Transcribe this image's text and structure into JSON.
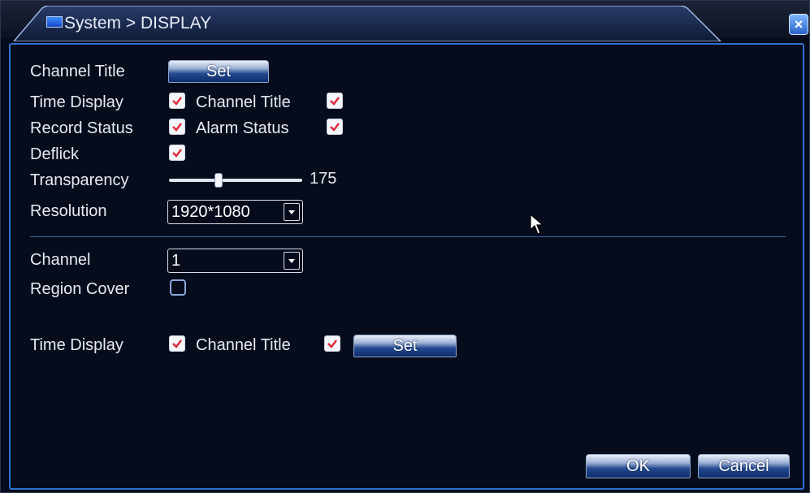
{
  "window": {
    "title": "System > DISPLAY",
    "close_label": "×"
  },
  "global": {
    "channel_title_label": "Channel Title",
    "set_label": "Set",
    "time_display_label": "Time Display",
    "time_display_checked": true,
    "channel_title_check_label": "Channel Title",
    "channel_title_checked": true,
    "record_status_label": "Record Status",
    "record_status_checked": true,
    "alarm_status_label": "Alarm Status",
    "alarm_status_checked": true,
    "deflick_label": "Deflick",
    "deflick_checked": true,
    "transparency_label": "Transparency",
    "transparency_value": "175",
    "transparency_min": 128,
    "transparency_max": 255,
    "resolution_label": "Resolution",
    "resolution_value": "1920*1080"
  },
  "channel_settings": {
    "channel_label": "Channel",
    "channel_value": "1",
    "region_cover_label": "Region Cover",
    "region_cover_checked": false,
    "time_display_label": "Time Display",
    "time_display_checked": true,
    "channel_title_label": "Channel Title",
    "channel_title_checked": true,
    "set_label": "Set"
  },
  "footer": {
    "ok_label": "OK",
    "cancel_label": "Cancel"
  },
  "colors": {
    "background": "#070c1c",
    "accent": "#2f6fd1",
    "check_mark": "#e0283a"
  }
}
